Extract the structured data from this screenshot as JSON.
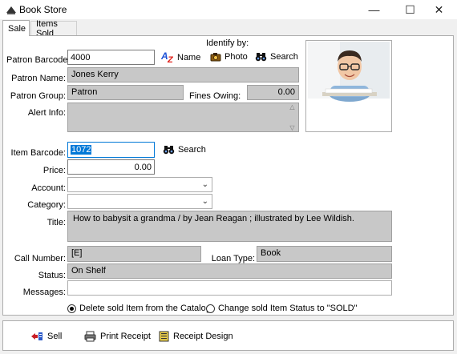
{
  "window": {
    "title": "Book Store",
    "minimize": "—",
    "maximize": "☐",
    "close": "✕"
  },
  "tabs": [
    {
      "label": "Sale"
    },
    {
      "label": "Items Sold"
    }
  ],
  "identify": {
    "heading": "Identify by:",
    "name_label": "Name",
    "photo_label": "Photo",
    "search_label": "Search",
    "az_a": "A",
    "az_z": "Z"
  },
  "patron": {
    "barcode_label": "Patron Barcode:",
    "barcode_value": "4000",
    "name_label": "Patron Name:",
    "name_value": "Jones Kerry",
    "group_label": "Patron Group:",
    "group_value": "Patron",
    "fines_label": "Fines Owing:",
    "fines_value": "0.00",
    "alert_label": "Alert Info:",
    "alert_value": ""
  },
  "item": {
    "barcode_label": "Item Barcode:",
    "barcode_value": "1072",
    "search_label": "Search",
    "price_label": "Price:",
    "price_value": "0.00",
    "account_label": "Account:",
    "account_value": "",
    "category_label": "Category:",
    "category_value": "",
    "title_label": "Title:",
    "title_value": "How to babysit a grandma /   by Jean Reagan ; illustrated by Lee Wildish.",
    "call_label": "Call Number:",
    "call_value": "[E]",
    "loan_label": "Loan Type:",
    "loan_value": "Book",
    "status_label": "Status:",
    "status_value": "On Shelf",
    "messages_label": "Messages:",
    "messages_value": ""
  },
  "options": {
    "delete_label": "Delete sold Item from the Catalog",
    "change_label": "Change sold Item Status to \"SOLD\"",
    "selected": "delete"
  },
  "actions": {
    "sell_label": "Sell",
    "print_label": "Print Receipt",
    "design_label": "Receipt Design"
  },
  "colors": {
    "selection": "#0078d7",
    "readonly": "#c8c8c8",
    "accent_blue": "#1a4fd6",
    "accent_red": "#e0201a"
  }
}
